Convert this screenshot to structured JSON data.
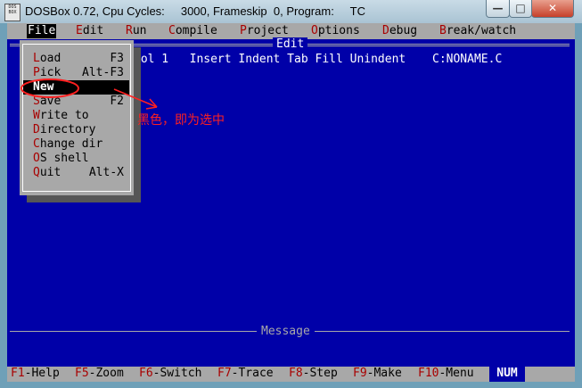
{
  "window": {
    "title": "DOSBox 0.72, Cpu Cycles:     3000, Frameskip  0, Program:     TC",
    "icon_text": "DOS BOX",
    "buttons": {
      "minimize": "—",
      "maximize": "□",
      "close": "✕"
    }
  },
  "menubar": {
    "items": [
      {
        "hotkey": "F",
        "rest": "ile"
      },
      {
        "hotkey": "E",
        "rest": "dit"
      },
      {
        "hotkey": "R",
        "rest": "un"
      },
      {
        "hotkey": "C",
        "rest": "ompile"
      },
      {
        "hotkey": "P",
        "rest": "roject"
      },
      {
        "hotkey": "O",
        "rest": "ptions"
      },
      {
        "hotkey": "D",
        "rest": "ebug"
      },
      {
        "hotkey": "B",
        "rest": "reak/watch"
      }
    ]
  },
  "edit": {
    "title": "Edit",
    "status": "Col 1   Insert Indent Tab Fill Unindent",
    "filename": "C:NONAME.C"
  },
  "file_menu": {
    "items": [
      {
        "hotkey": "L",
        "rest": "oad",
        "shortcut": "F3"
      },
      {
        "hotkey": "P",
        "rest": "ick",
        "shortcut": "Alt-F3"
      },
      {
        "hotkey": "N",
        "rest": "ew",
        "shortcut": ""
      },
      {
        "hotkey": "S",
        "rest": "ave",
        "shortcut": "F2"
      },
      {
        "hotkey": "W",
        "rest": "rite to",
        "shortcut": ""
      },
      {
        "hotkey": "D",
        "rest": "irectory",
        "shortcut": ""
      },
      {
        "hotkey": "C",
        "rest": "hange dir",
        "shortcut": ""
      },
      {
        "hotkey": "O",
        "rest": "S shell",
        "shortcut": ""
      },
      {
        "hotkey": "Q",
        "rest": "uit",
        "shortcut": "Alt-X"
      }
    ],
    "selected_index": 2
  },
  "message": {
    "title": "Message"
  },
  "function_keys": [
    {
      "key": "F1",
      "label": "-Help"
    },
    {
      "key": "F5",
      "label": "-Zoom"
    },
    {
      "key": "F6",
      "label": "-Switch"
    },
    {
      "key": "F7",
      "label": "-Trace"
    },
    {
      "key": "F8",
      "label": "-Step"
    },
    {
      "key": "F9",
      "label": "-Make"
    },
    {
      "key": "F10",
      "label": "-Menu"
    }
  ],
  "num_indicator": "NUM",
  "annotation": {
    "text": "黑色，即为选中",
    "color": "#ff2020"
  },
  "colors": {
    "dos_blue": "#0000a8",
    "dos_gray": "#a8a8a8",
    "hotkey_red": "#a80000"
  }
}
